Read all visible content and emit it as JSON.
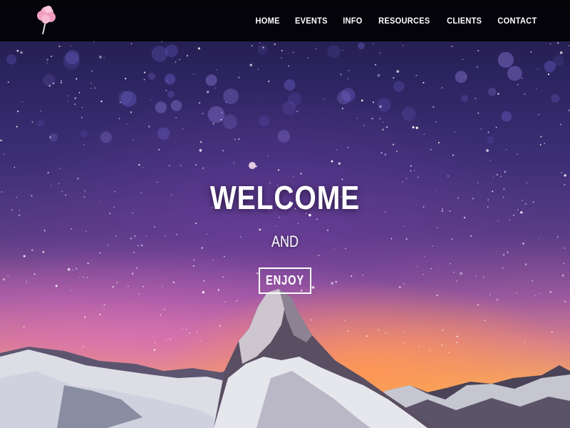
{
  "navbar": {
    "logo_icon": "cotton-candy-icon",
    "links": [
      {
        "label": "HOME"
      },
      {
        "label": "EVENTS"
      },
      {
        "label": "INFO"
      },
      {
        "label": "RESOURCES"
      },
      {
        "label": "CLIENTS"
      },
      {
        "label": "CONTACT"
      }
    ]
  },
  "hero": {
    "title": "WELCOME",
    "subtitle": "AND",
    "cta_label": "ENJOY",
    "background": "starry-night-mountain-image"
  },
  "colors": {
    "navbar_bg": "#000000",
    "text": "#ffffff",
    "logo_pink": "#f2a7c3"
  }
}
